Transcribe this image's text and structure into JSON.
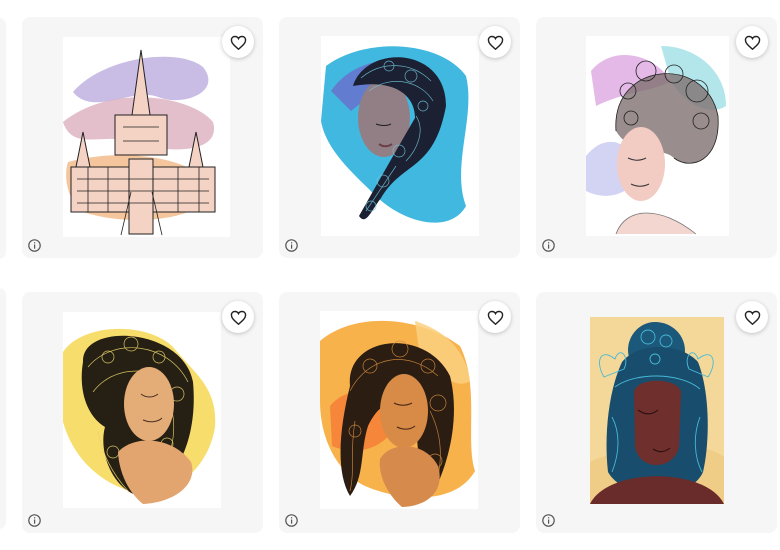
{
  "gallery": {
    "items": [
      {
        "title": "",
        "favorite_icon": "heart-outline-icon",
        "info_icon": "info-circle-icon",
        "accent": "#b9a7d7"
      },
      {
        "title": "",
        "favorite_icon": "heart-outline-icon",
        "info_icon": "info-circle-icon",
        "accent": "#2ca7d6"
      },
      {
        "title": "",
        "favorite_icon": "heart-outline-icon",
        "info_icon": "info-circle-icon",
        "accent": "#d39bd8"
      },
      {
        "title": "",
        "favorite_icon": "heart-outline-icon",
        "info_icon": "info-circle-icon",
        "accent": "#f2d04c"
      },
      {
        "title": "",
        "favorite_icon": "heart-outline-icon",
        "info_icon": "info-circle-icon",
        "accent": "#f39a28"
      },
      {
        "title": "",
        "favorite_icon": "heart-outline-icon",
        "info_icon": "info-circle-icon",
        "accent": "#2f9fc8"
      }
    ]
  }
}
